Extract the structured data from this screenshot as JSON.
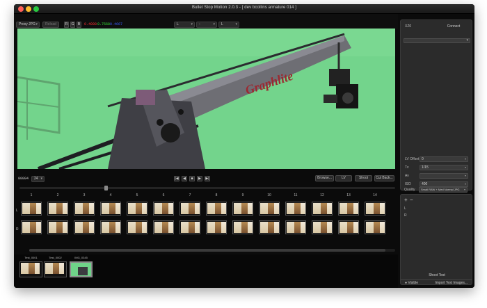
{
  "window": {
    "title": "Bullet Stop Motion 2.0.3 - [ dev bcollins armature 014 ]"
  },
  "toolbar": {
    "proxy_select": "Proxy JPG",
    "reload_label": "Reload",
    "btn_a": "R",
    "btn_b": "G",
    "btn_c": "B",
    "coord_r": "0.4098",
    "coord_g": "0.7568",
    "coord_b": "0.4667",
    "coord_r_color": "#ff3030",
    "coord_g_color": "#35e035",
    "coord_b_color": "#3b5cff",
    "sel1": "L",
    "sel2": "-",
    "sel3": "L"
  },
  "viewer": {
    "crane_text": "Graphlite",
    "bg_color": "#6fd389"
  },
  "transport": {
    "frame_no": "00004",
    "fps": "24",
    "buttons": [
      "|◀",
      "◀",
      "■",
      "▶",
      "▶|"
    ],
    "browse": "Browse...",
    "lv": "LV",
    "shoot": "Shoot",
    "cut_back": "Cut Back..."
  },
  "strip": {
    "columns": [
      "1",
      "2",
      "3",
      "4",
      "5",
      "6",
      "7",
      "8",
      "9",
      "10",
      "11",
      "12",
      "13",
      "14"
    ],
    "row_l": "L",
    "row_r": "R"
  },
  "tests": [
    {
      "label": "Test_0001"
    },
    {
      "label": "Test_0002"
    },
    {
      "label": "IMG_0345"
    }
  ],
  "side": {
    "iso_label": "XZ0",
    "connect": "Connect",
    "fields": [
      {
        "label": "LV Offset",
        "value": "0"
      },
      {
        "label": "Tv",
        "value": "1/15"
      },
      {
        "label": "Av",
        "value": ""
      },
      {
        "label": "ISO",
        "value": "400"
      },
      {
        "label": "Quality",
        "value": "Small RAW + Med Normal JPG"
      }
    ],
    "plus": "+",
    "minus": "−",
    "list_l": "L",
    "list_r": "R",
    "shoot_test": "Shoot Test",
    "visible_label": "Visible",
    "visible_check": "●",
    "import_label": "Import Test Images..."
  }
}
